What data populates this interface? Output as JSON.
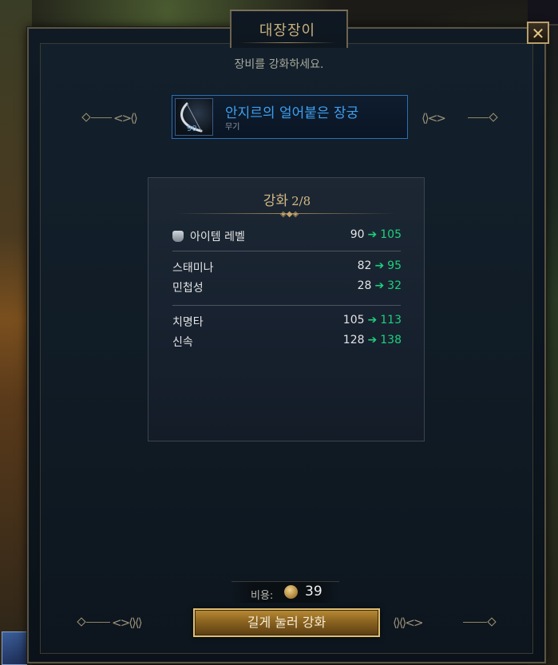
{
  "window": {
    "title": "대장장이",
    "subtitle": "장비를 강화하세요.",
    "close_label": "✕"
  },
  "item": {
    "name": "안지르의 얼어붙은 장궁",
    "type": "무기",
    "level": "90",
    "rarity_color": "#3ea0f0"
  },
  "enhance": {
    "title": "강화",
    "progress": "2/8",
    "stats": [
      {
        "label": "아이템 레벨",
        "old": "90",
        "new": "105",
        "icon": "armor-icon"
      },
      {
        "label": "스태미나",
        "old": "82",
        "new": "95"
      },
      {
        "label": "민첩성",
        "old": "28",
        "new": "32"
      },
      {
        "label": "치명타",
        "old": "105",
        "new": "113"
      },
      {
        "label": "신속",
        "old": "128",
        "new": "138"
      }
    ],
    "increase_color": "#1dd07d"
  },
  "cost": {
    "label": "비용:",
    "value": "39",
    "icon": "coin-icon"
  },
  "action": {
    "button_label": "길게 눌러 강화"
  }
}
